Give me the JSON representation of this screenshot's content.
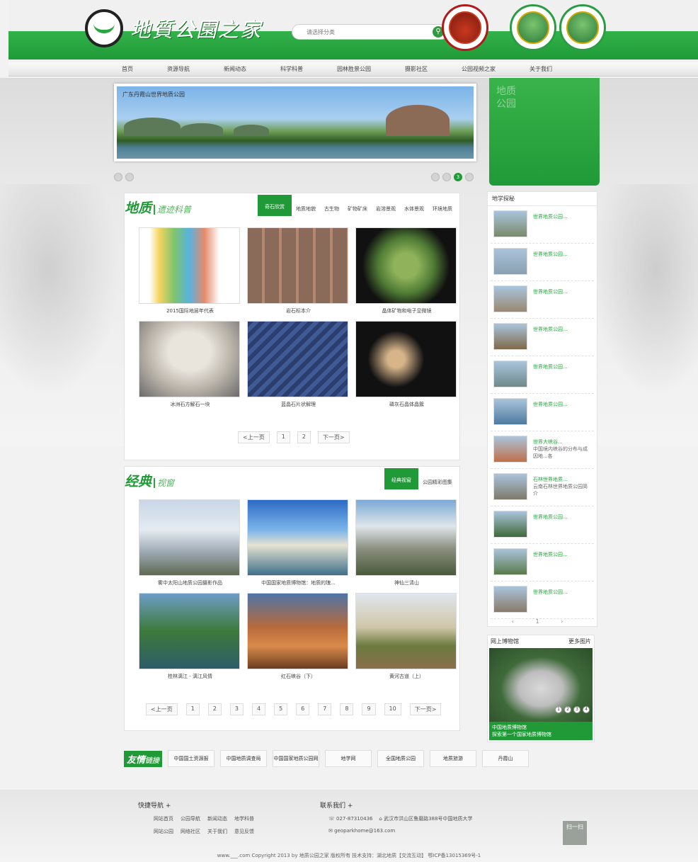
{
  "header": {
    "site_name": "地質公園之家",
    "search_select": "请选择分类",
    "search_icon": "search-icon"
  },
  "nav": {
    "items": [
      "首页",
      "资源导航",
      "新闻动态",
      "科学科普",
      "园林胜景公园",
      "摄影社区",
      "公园视频之家",
      "关于我们"
    ]
  },
  "banner": {
    "caption": "广东丹霞山世界地质公园",
    "current_slide": "3"
  },
  "promo_block": {
    "text": "地质公园"
  },
  "section_geo": {
    "title": "地质",
    "subtitle": "遗迹科普",
    "tabs": [
      "奇石欣赏",
      "地质地貌",
      "古生物",
      "矿物矿床",
      "岩溶景观",
      "水体景观",
      "环境地质"
    ],
    "items": [
      {
        "caption": "2015国际地层年代表"
      },
      {
        "caption": "岩石标本介"
      },
      {
        "caption": "晶体矿物和电子显微镜"
      },
      {
        "caption": "冰洲石方解石一块"
      },
      {
        "caption": "蓝晶石片状解理"
      },
      {
        "caption": "磷灰石晶体晶簇"
      }
    ],
    "pager": [
      "<上一页",
      "1",
      "2",
      "下一页>"
    ]
  },
  "section_classic": {
    "title": "经典",
    "subtitle": "视窗",
    "tabs": [
      "经典视窗",
      "公园精彩图集"
    ],
    "items": [
      {
        "caption": "雾中太阳山地质公园摄影作品"
      },
      {
        "caption": "中国国家地质博物馆：地质的瑰..."
      },
      {
        "caption": "神仙三清山"
      },
      {
        "caption": "桂林漓江 - 漓江风情"
      },
      {
        "caption": "红石峡谷（下）"
      },
      {
        "caption": "黄河古道（上）"
      }
    ],
    "pager": [
      "<上一页",
      "1",
      "2",
      "3",
      "4",
      "5",
      "6",
      "7",
      "8",
      "9",
      "10",
      "下一页>"
    ]
  },
  "sidebar": {
    "heading": "地学探秘",
    "items": [
      {
        "title": "世界地质公园...",
        "sub": ""
      },
      {
        "title": "世界地质公园...",
        "sub": ""
      },
      {
        "title": "世界地质公园...",
        "sub": ""
      },
      {
        "title": "世界地质公园...",
        "sub": ""
      },
      {
        "title": "世界地质公园...",
        "sub": ""
      },
      {
        "title": "世界地质公园...",
        "sub": ""
      },
      {
        "title": "世界大峡谷...",
        "sub": "中国境内峡谷的分布与成因地...各"
      },
      {
        "title": "石林世界地质...",
        "sub": "云南石林世界地质公园简介"
      },
      {
        "title": "世界地质公园...",
        "sub": ""
      },
      {
        "title": "世界地质公园...",
        "sub": ""
      },
      {
        "title": "世界地质公园...",
        "sub": ""
      }
    ],
    "pager": "‹  1  ›"
  },
  "promo2": {
    "title": "网上博物馆",
    "more": "更多图片",
    "dots": [
      "1",
      "2",
      "3",
      "4"
    ],
    "caption_line1": "中国地质博物馆",
    "caption_line2": "探索第一个国家地质博物馆"
  },
  "links": {
    "title": "友情",
    "subtitle": "链接",
    "logos": [
      "中国国土资源报",
      "中国地质调查局",
      "中国国家地质公园网",
      "地学网",
      "全国地质公园",
      "地质旅游",
      "丹霞山"
    ]
  },
  "footer": {
    "nav_title": "快捷导航 +",
    "nav_links": [
      "网站首页",
      "公园导航",
      "新闻动态",
      "地学科普",
      "网站公园",
      "网络社区",
      "关于我们",
      "意见反馈"
    ],
    "contact_title": "联系我们 +",
    "phone": "027-87310436",
    "address": "武汉市洪山区鲁磨路388号中国地质大学",
    "email": "geoparkhome@163.com",
    "qr_label": "扫一扫",
    "copyright": "www.___.com Copyright 2013 by 地质公园之家 版权所有 技术支持：湖北地质【交流互动】 鄂ICP备13015369号-1"
  },
  "colors": {
    "brand_green": "#1f9a37",
    "accent_green": "#2aa640"
  }
}
